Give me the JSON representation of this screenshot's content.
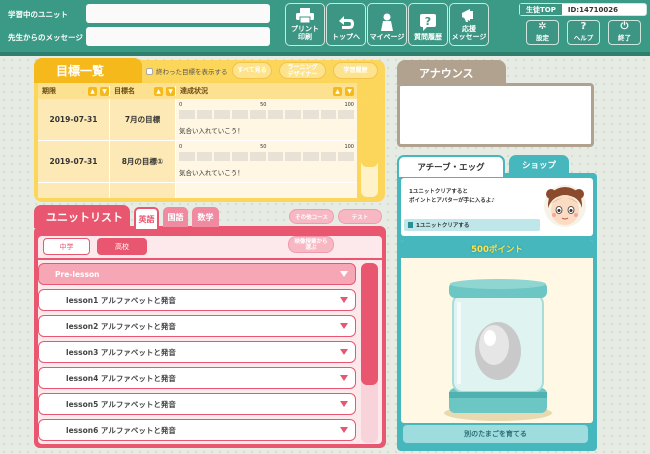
{
  "header": {
    "unit_label": "学習中のユニット",
    "message_label": "先生からのメッセージ",
    "buttons": [
      {
        "label": "プリント\n印刷",
        "icon": "printer-icon"
      },
      {
        "label": "トップへ",
        "icon": "back-arrow-icon"
      },
      {
        "label": "マイページ",
        "icon": "person-icon"
      },
      {
        "label": "質問履歴",
        "icon": "question-icon"
      },
      {
        "label": "応援\nメッセージ",
        "icon": "megaphone-icon"
      }
    ],
    "student_top": "生徒TOP",
    "student_id": "ID:14710026",
    "small_buttons": [
      {
        "label": "設定",
        "icon": "gear-icon"
      },
      {
        "label": "ヘルプ",
        "icon": "help-icon"
      },
      {
        "label": "終了",
        "icon": "exit-icon"
      }
    ]
  },
  "goals": {
    "title": "目標一覧",
    "show_done_label": "終わった目標を表示する",
    "btn_all": "すべて見る",
    "btn_designer": "ラーニング\nデザイナー",
    "btn_history": "学習履歴",
    "columns": [
      "期限",
      "目標名",
      "達成状況"
    ],
    "scale": [
      "0",
      "50",
      "100"
    ],
    "rows": [
      {
        "date": "2019-07-31",
        "name": "7月の目標",
        "comment": "気合い入れていこう！"
      },
      {
        "date": "2019-07-31",
        "name": "8月の目標①",
        "comment": "気合い入れていこう！"
      }
    ]
  },
  "units": {
    "title": "ユニットリスト",
    "subjects": [
      "英語",
      "国語",
      "数学"
    ],
    "btn_other": "その他コース",
    "btn_test": "テスト",
    "levels": [
      "中学",
      "高校"
    ],
    "btn_choose": "映像授業から\n選ぶ",
    "pre_lesson": "Pre-lesson",
    "lessons": [
      "lesson1 アルファベットと発音",
      "lesson2 アルファベットと発音",
      "lesson3 アルファベットと発音",
      "lesson4 アルファベットと発音",
      "lesson5 アルファベットと発音",
      "lesson6 アルファベットと発音"
    ]
  },
  "announce": {
    "title": "アナウンス"
  },
  "achieve": {
    "tab_egg": "アチーブ・エッグ",
    "tab_shop": "ショップ",
    "msg_line1": "1ユニットクリアすると",
    "msg_line2": "ポイントとアバターが手に入るよ♪",
    "flag_text": "1ユニットクリアする",
    "points": "500ポイント",
    "grow_button": "別のたまごを育てる"
  }
}
